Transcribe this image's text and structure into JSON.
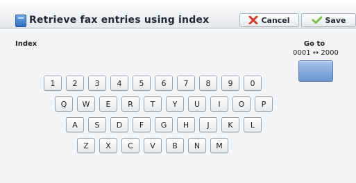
{
  "header": {
    "title": "Retrieve fax entries using index",
    "cancel_label": "Cancel",
    "save_label": "Save",
    "title_icon": "folder-icon",
    "cancel_icon": "x-icon",
    "save_icon": "check-icon",
    "cancel_icon_color": "#d23a2a",
    "save_icon_color": "#7ac143"
  },
  "index": {
    "label": "Index"
  },
  "goto": {
    "label": "Go to",
    "range": "0001 ↔ 2000"
  },
  "keyboard": {
    "row1": [
      "1",
      "2",
      "3",
      "4",
      "5",
      "6",
      "7",
      "8",
      "9",
      "0"
    ],
    "row2": [
      "Q",
      "W",
      "E",
      "R",
      "T",
      "Y",
      "U",
      "I",
      "O",
      "P"
    ],
    "row3": [
      "A",
      "S",
      "D",
      "F",
      "G",
      "H",
      "J",
      "K",
      "L"
    ],
    "row4": [
      "Z",
      "X",
      "C",
      "V",
      "B",
      "N",
      "M"
    ]
  }
}
